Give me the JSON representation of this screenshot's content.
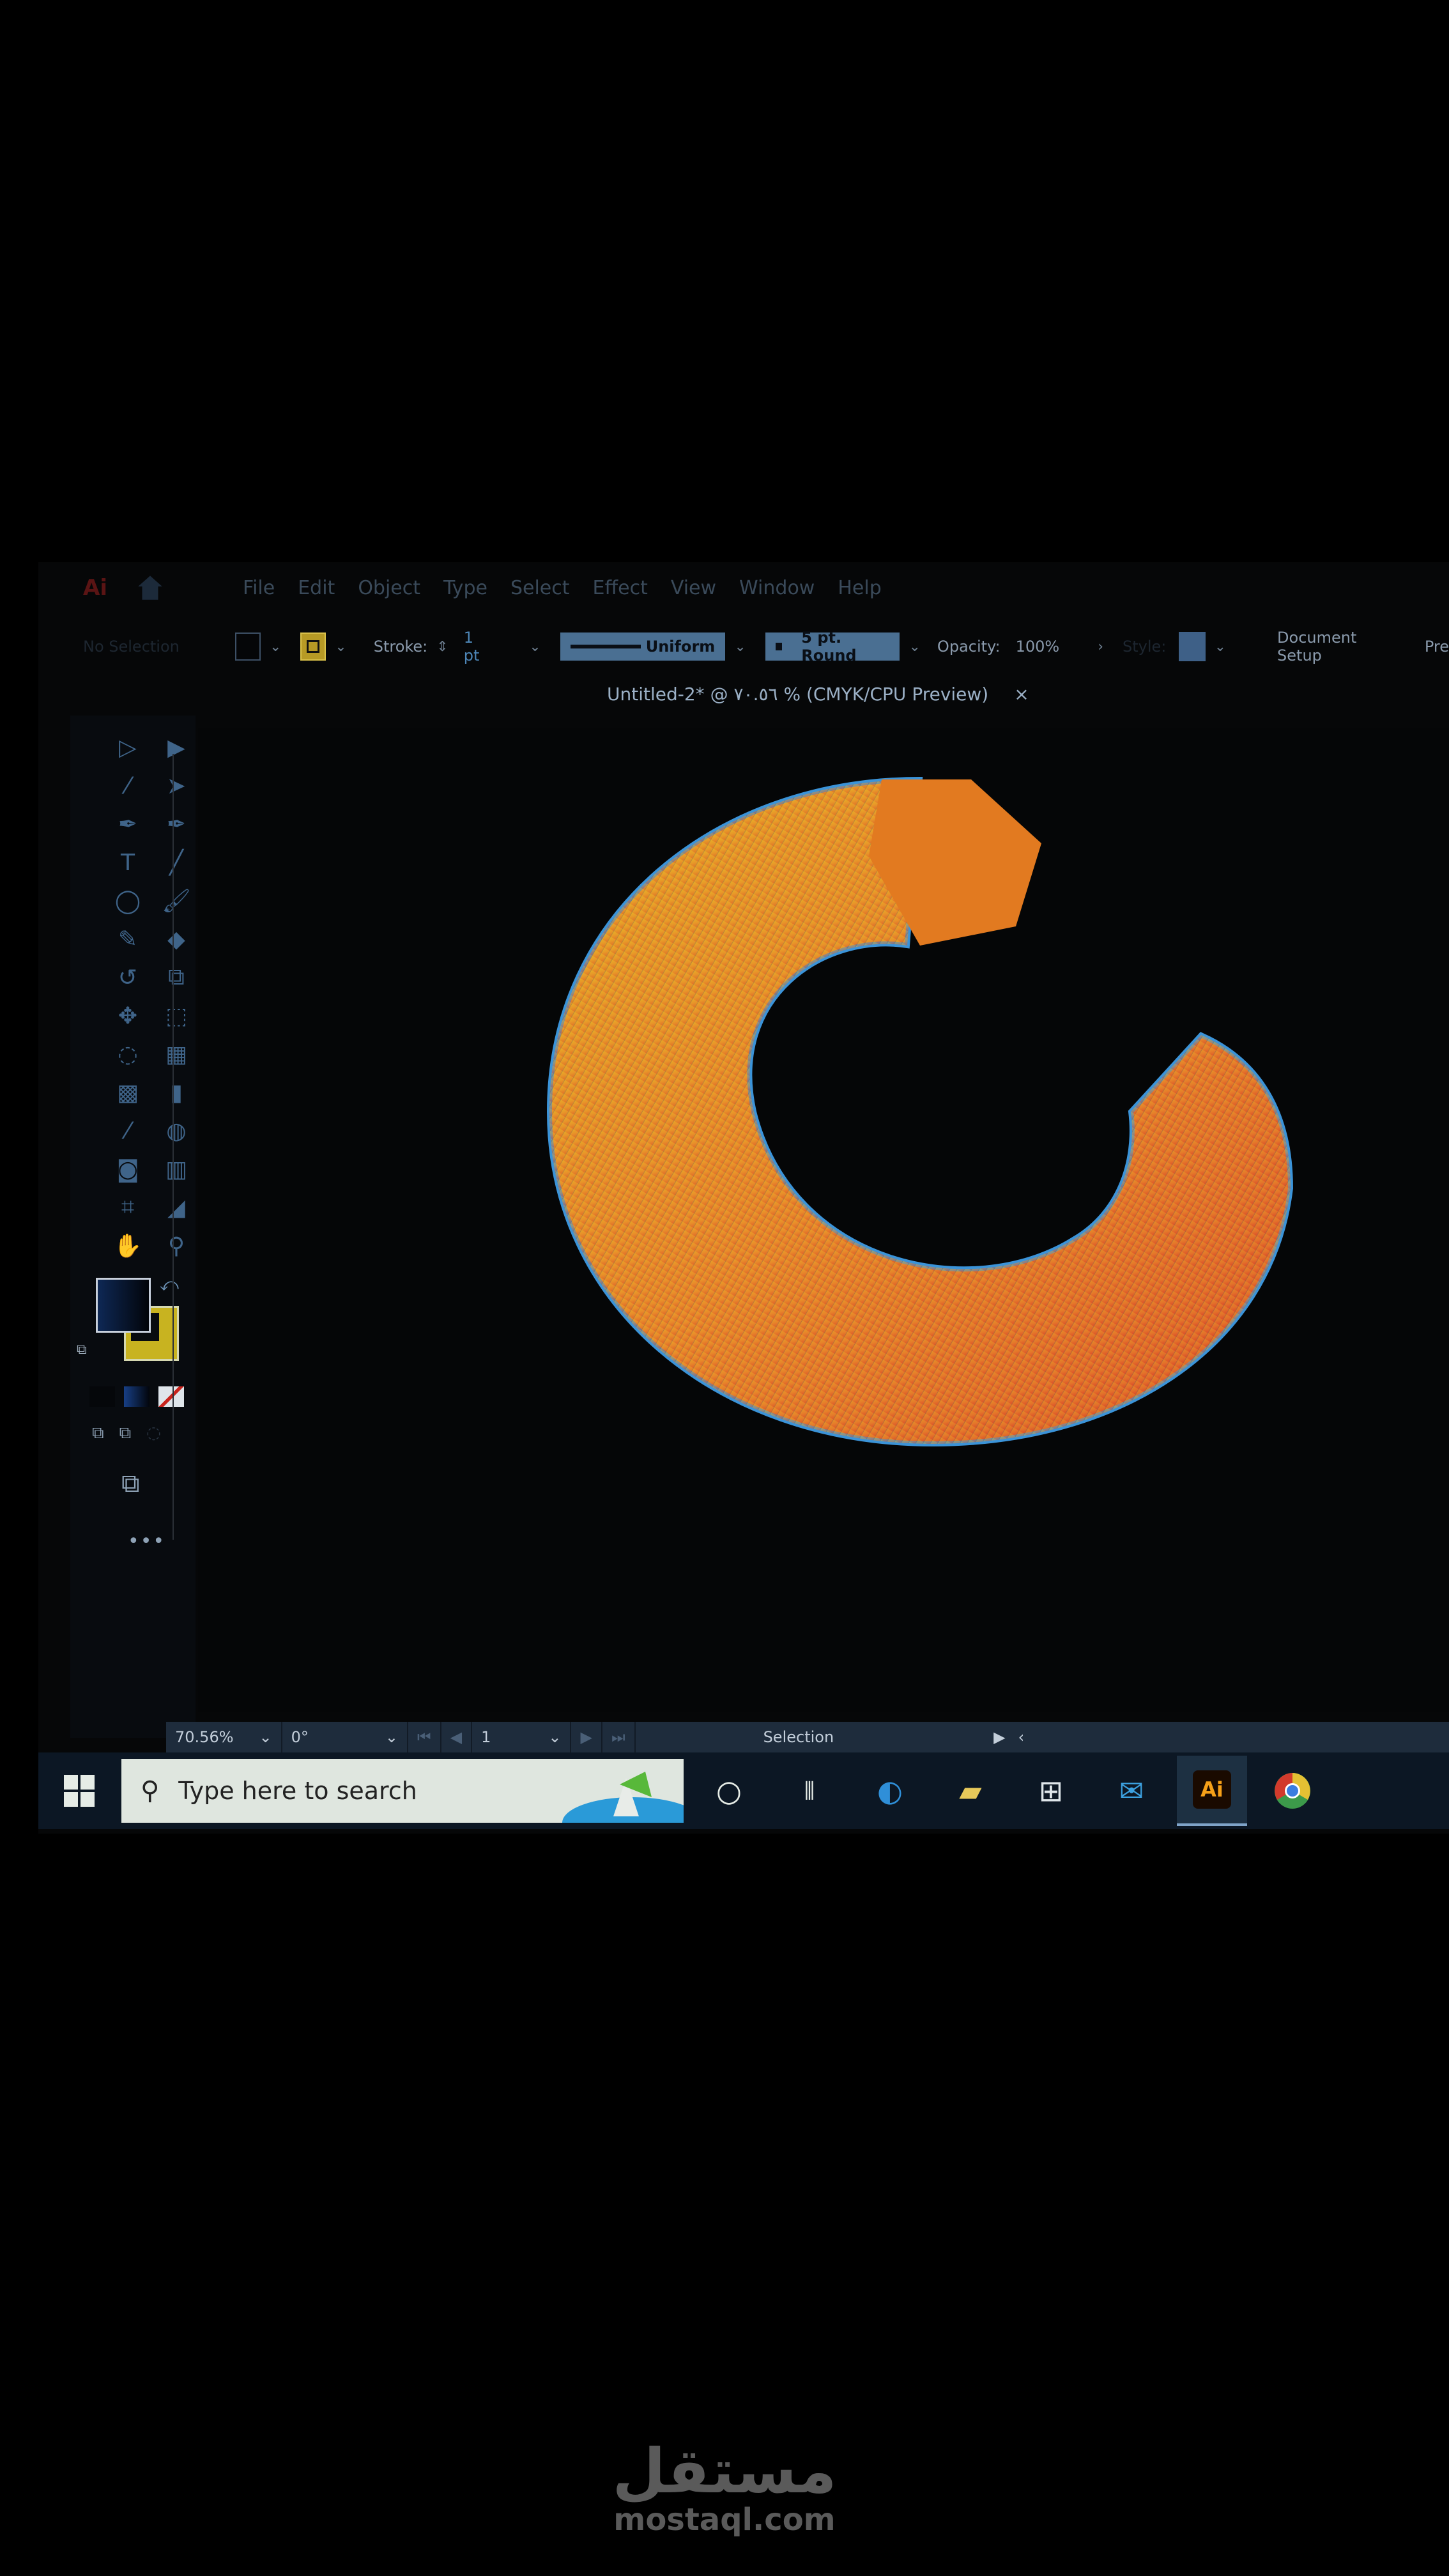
{
  "app": {
    "name": "Adobe Illustrator",
    "logo_text": "Ai"
  },
  "menu": {
    "items": [
      "File",
      "Edit",
      "Object",
      "Type",
      "Select",
      "Effect",
      "View",
      "Window",
      "Help"
    ]
  },
  "control_bar": {
    "selection_state": "No Selection",
    "stroke_label": "Stroke:",
    "stroke_weight": "1 pt",
    "profile": "Uniform",
    "brush": "5 pt. Round",
    "opacity_label": "Opacity:",
    "opacity_value": "100%",
    "style_label": "Style:",
    "document_setup": "Document Setup",
    "preferences_partial": "Pre"
  },
  "document_tab": {
    "title": "Untitled-2* @ ٧٠.٥٦ % (CMYK/CPU Preview)",
    "close": "×"
  },
  "toolbar": {
    "tools": [
      "selection",
      "direct-selection",
      "magic-wand",
      "lasso",
      "pen",
      "curvature",
      "type",
      "line-segment",
      "ellipse",
      "paintbrush",
      "shaper",
      "eraser",
      "rotate",
      "scale",
      "puppet-warp",
      "free-transform",
      "shape-builder",
      "perspective-grid",
      "mesh",
      "gradient",
      "eyedropper",
      "blend",
      "symbol-sprayer",
      "column-graph",
      "artboard",
      "slice",
      "hand",
      "zoom"
    ],
    "fill_color": "#0e2855",
    "stroke_color": "#c8b320",
    "more": "•••"
  },
  "status_bar": {
    "zoom": "70.56%",
    "rotation": "0°",
    "artboard": "1",
    "current_tool": "Selection"
  },
  "taskbar": {
    "search_placeholder": "Type here to search",
    "apps": [
      "cortana",
      "task-view",
      "edge",
      "file-explorer",
      "microsoft-store",
      "mail",
      "illustrator",
      "chrome"
    ],
    "active_app": "illustrator"
  },
  "artwork": {
    "colors": {
      "warm_start": "#e6b826",
      "warm_mid": "#e8892a",
      "warm_end": "#d8402a",
      "edge": "#3b93d8"
    }
  },
  "watermark": {
    "arabic": "مستقل",
    "latin": "mostaql.com"
  }
}
